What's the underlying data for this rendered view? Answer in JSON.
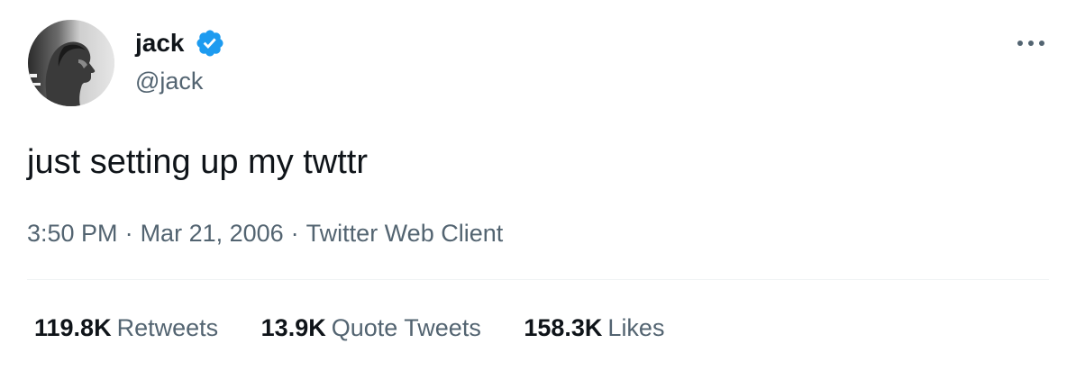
{
  "tweet": {
    "author": {
      "display_name": "jack",
      "handle": "@jack",
      "verified": true,
      "verified_icon": "verified-badge-icon",
      "avatar": "avatar-photo"
    },
    "more_icon": "more-horizontal-icon",
    "text": "just setting up my twttr",
    "time": "3:50 PM",
    "date": "Mar 21, 2006",
    "separator": "·",
    "source": "Twitter Web Client",
    "stats": {
      "retweets": {
        "count": "119.8K",
        "label": "Retweets"
      },
      "quote_tweets": {
        "count": "13.9K",
        "label": "Quote Tweets"
      },
      "likes": {
        "count": "158.3K",
        "label": "Likes"
      }
    }
  },
  "colors": {
    "primary_text": "#0f1419",
    "secondary_text": "#536471",
    "verified_blue": "#1d9bf0",
    "divider": "#eff3f4"
  }
}
